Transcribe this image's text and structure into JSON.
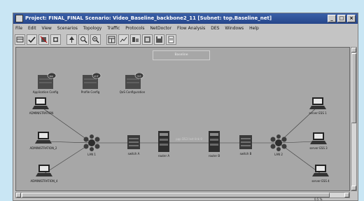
{
  "window": {
    "title": "Project: FINAL_FINAL Scenario: Video_Baseline_backbone2_11 [Subnet: top.Baseline_net]",
    "buttons": {
      "minimize": "_",
      "maximize": "□",
      "close": "×"
    }
  },
  "menu": [
    "File",
    "Edit",
    "View",
    "Scenarios",
    "Topology",
    "Traffic",
    "Protocols",
    "NetDoctor",
    "Flow Analysis",
    "DES",
    "Windows",
    "Help"
  ],
  "toolbar": [
    "open-object-palette-icon",
    "check-link-consistency-icon",
    "fail-node-icon",
    "recover-node-icon",
    "zoom-fit-icon",
    "zoom-in-icon",
    "zoom-out-icon",
    "configure-discrete-event-simulation-icon",
    "view-results-icon",
    "hide-graphs-icon",
    "view-web-report-icon",
    "save-icon",
    "log-icon"
  ],
  "canvas": {
    "hint_box": "Baseline",
    "config_objects": [
      {
        "label": "Application Config",
        "badge": "app"
      },
      {
        "label": "Profile Config",
        "badge": "prof"
      },
      {
        "label": "QoS Configuration",
        "badge": "QoS"
      }
    ],
    "left_clients": [
      "ADMINISTRATION",
      "ADMINISTRATION_2",
      "ADMINISTRATION_4"
    ],
    "right_servers": [
      "server ESS 1",
      "server ESS 3",
      "server ESS 4"
    ],
    "backbone_nodes": [
      "LAN 1",
      "switch A",
      "router A",
      "router B",
      "switch B",
      "LAN 2"
    ],
    "link_label": "ppp DS3 Inst link 0"
  },
  "status": {
    "zoom": "0.5 %"
  },
  "colors": {
    "titlebar": "#2f53a0",
    "canvas": "#a7a7a7",
    "window": "#c4c4c4",
    "page": "#c9e6f4"
  }
}
